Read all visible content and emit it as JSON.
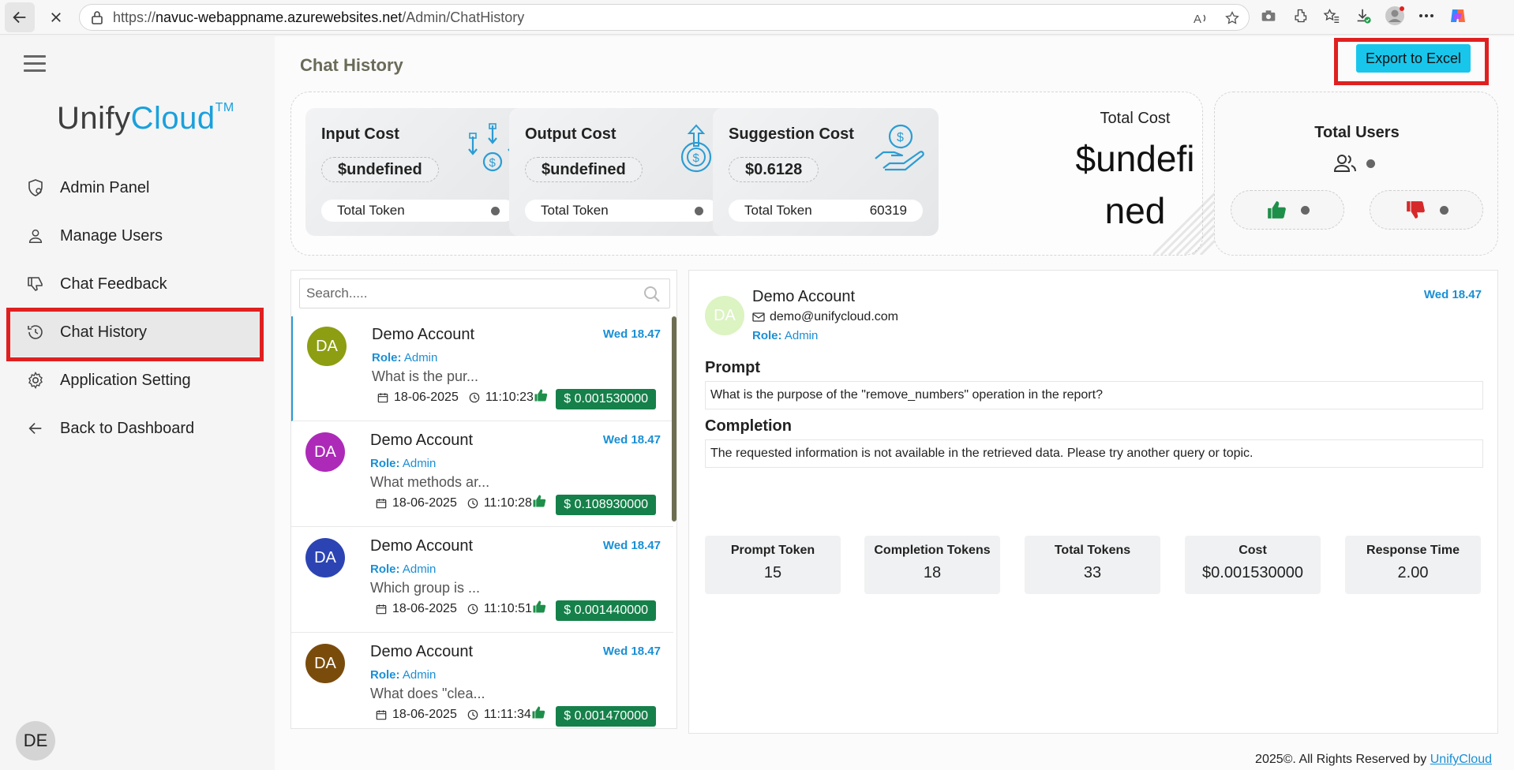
{
  "browser": {
    "url_prefix": "https://",
    "url_host": "navuc-webappname.azurewebsites.net",
    "url_path": "/Admin/ChatHistory"
  },
  "brand": {
    "name_part1": "Unify",
    "name_part2": "Cloud",
    "tm": "TM"
  },
  "sidebar": {
    "items": [
      {
        "label": "Admin Panel",
        "icon": "shield-gear-icon"
      },
      {
        "label": "Manage Users",
        "icon": "user-icon"
      },
      {
        "label": "Chat Feedback",
        "icon": "thumbs-down-icon"
      },
      {
        "label": "Chat History",
        "icon": "history-icon",
        "active": true
      },
      {
        "label": "Application Setting",
        "icon": "gear-icon"
      },
      {
        "label": "Back to Dashboard",
        "icon": "arrow-left-icon"
      }
    ],
    "user_initials": "DE"
  },
  "page": {
    "title": "Chat History",
    "export_label": "Export to Excel"
  },
  "stats": {
    "input": {
      "title": "Input Cost",
      "value": "$undefined",
      "token_label": "Total Token",
      "token_value": ""
    },
    "output": {
      "title": "Output Cost",
      "value": "$undefined",
      "token_label": "Total Token",
      "token_value": ""
    },
    "suggestion": {
      "title": "Suggestion Cost",
      "value": "$0.6128",
      "token_label": "Total Token",
      "token_value": "60319"
    },
    "total_cost": {
      "label": "Total Cost",
      "value": "$undefined"
    }
  },
  "users": {
    "title": "Total Users"
  },
  "search": {
    "placeholder": "Search....."
  },
  "chats": [
    {
      "initials": "DA",
      "name": "Demo Account",
      "date": "Wed 18.47",
      "role_label": "Role:",
      "role": "Admin",
      "text": "What is the pur...",
      "day": "18-06-2025",
      "time": "11:10:23",
      "cost": "$ 0.001530000",
      "avatar_color": "#8d9e12"
    },
    {
      "initials": "DA",
      "name": "Demo Account",
      "date": "Wed 18.47",
      "role_label": "Role:",
      "role": "Admin",
      "text": "What methods ar...",
      "day": "18-06-2025",
      "time": "11:10:28",
      "cost": "$ 0.108930000",
      "avatar_color": "#ad2ab8"
    },
    {
      "initials": "DA",
      "name": "Demo Account",
      "date": "Wed 18.47",
      "role_label": "Role:",
      "role": "Admin",
      "text": "Which group is ...",
      "day": "18-06-2025",
      "time": "11:10:51",
      "cost": "$ 0.001440000",
      "avatar_color": "#2c44b3"
    },
    {
      "initials": "DA",
      "name": "Demo Account",
      "date": "Wed 18.47",
      "role_label": "Role:",
      "role": "Admin",
      "text": "What does \"clea...",
      "day": "18-06-2025",
      "time": "11:11:34",
      "cost": "$ 0.001470000",
      "avatar_color": "#7a4c0c"
    }
  ],
  "detail": {
    "initials": "DA",
    "name": "Demo  Account",
    "email": "demo@unifycloud.com",
    "role_label": "Role:",
    "role": "Admin",
    "date": "Wed 18.47",
    "prompt_title": "Prompt",
    "prompt_text": "What is the purpose of the \"remove_numbers\" operation in the report?",
    "completion_title": "Completion",
    "completion_text": "The requested information is not available in the retrieved data. Please try another query or topic.",
    "metrics": [
      {
        "label": "Prompt Token",
        "value": "15"
      },
      {
        "label": "Completion Tokens",
        "value": "18"
      },
      {
        "label": "Total Tokens",
        "value": "33"
      },
      {
        "label": "Cost",
        "value": "$0.001530000"
      },
      {
        "label": "Response Time",
        "value": "2.00"
      }
    ]
  },
  "footer": {
    "text": "2025©. All Rights Reserved by ",
    "link": "UnifyCloud"
  },
  "colors": {
    "accent": "#1aa0dc",
    "export_button": "#18c6ec",
    "cost_badge": "#16804a",
    "highlight_box": "#e02020"
  }
}
